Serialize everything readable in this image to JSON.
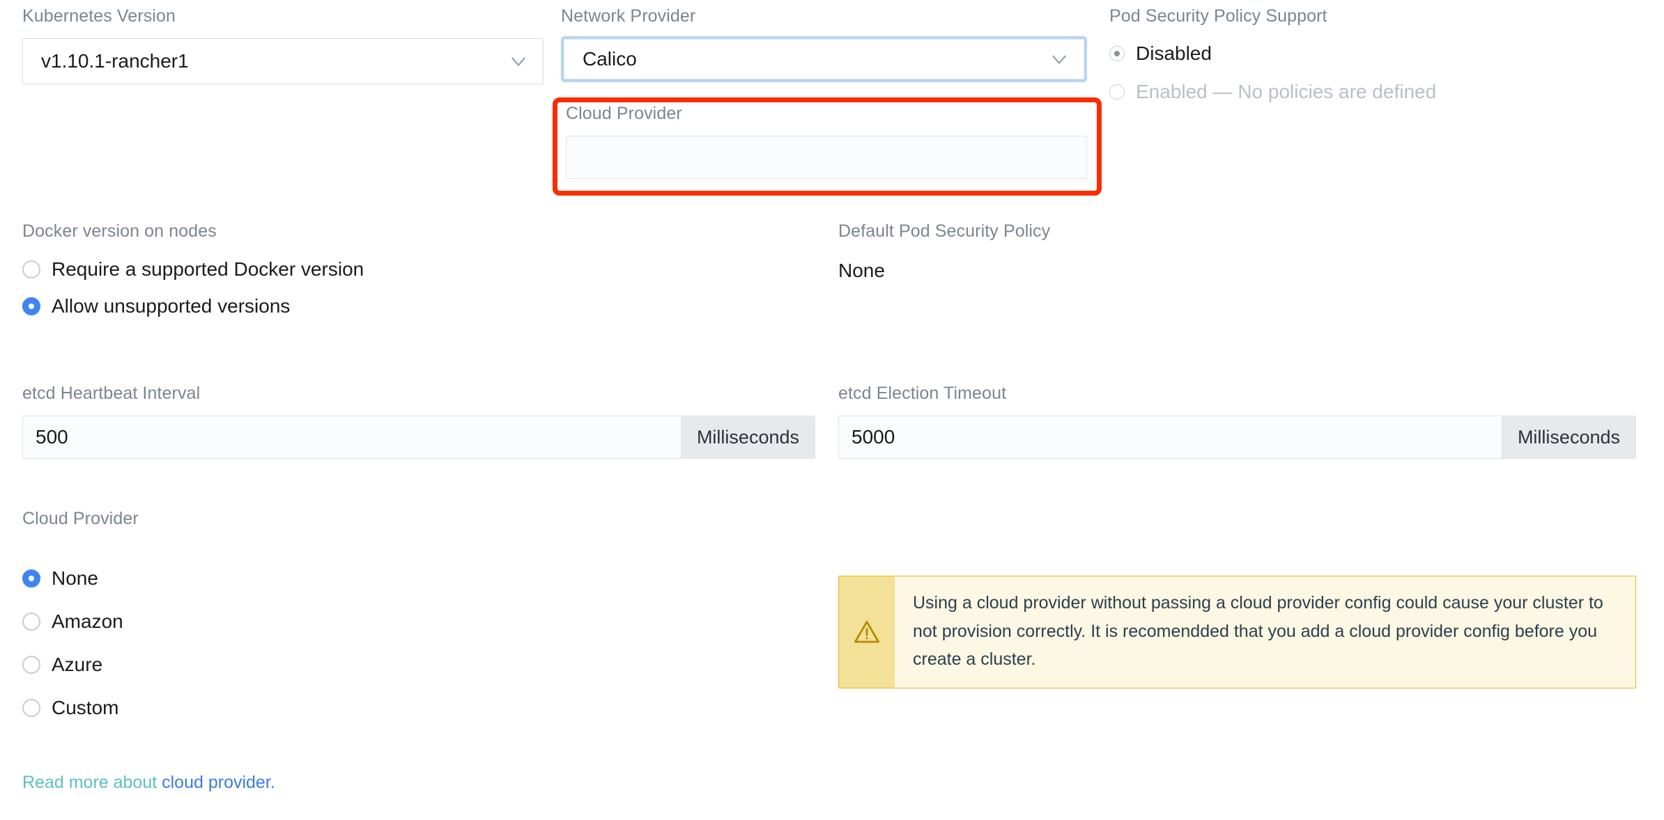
{
  "colors": {
    "accent_blue": "#3d86f2",
    "focus_ring": "#b8d4f5",
    "annotation_red": "#f92d00",
    "warning_border": "#e6b822",
    "warning_bg": "#fdf8e3",
    "warning_icon_bg": "#f2e196",
    "link_teal": "#5bc0bd",
    "link_blue": "#3a7ce0",
    "label_grey": "#7b8590"
  },
  "kubernetes_version": {
    "label": "Kubernetes Version",
    "value": "v1.10.1-rancher1",
    "chevron": "chevron-down-icon"
  },
  "network_provider": {
    "label": "Network Provider",
    "value": "Calico",
    "chevron": "chevron-down-icon",
    "focused": true
  },
  "cloud_provider_select": {
    "label": "Cloud Provider",
    "value": "",
    "highlighted": true
  },
  "pod_security_policy_support": {
    "label": "Pod Security Policy Support",
    "options": [
      {
        "label": "Disabled",
        "selected": true,
        "disabled": false
      },
      {
        "label": "Enabled — No policies are defined",
        "selected": false,
        "disabled": true
      }
    ]
  },
  "docker_version": {
    "label": "Docker version on nodes",
    "options": [
      {
        "label": "Require a supported Docker version",
        "selected": false
      },
      {
        "label": "Allow unsupported versions",
        "selected": true
      }
    ]
  },
  "default_pod_security_policy": {
    "label": "Default Pod Security Policy",
    "value": "None"
  },
  "etcd_heartbeat_interval": {
    "label": "etcd Heartbeat Interval",
    "value": "500",
    "unit": "Milliseconds"
  },
  "etcd_election_timeout": {
    "label": "etcd Election Timeout",
    "value": "5000",
    "unit": "Milliseconds"
  },
  "cloud_provider_radios": {
    "label": "Cloud Provider",
    "options": [
      {
        "label": "None",
        "selected": true
      },
      {
        "label": "Amazon",
        "selected": false
      },
      {
        "label": "Azure",
        "selected": false
      },
      {
        "label": "Custom",
        "selected": false
      }
    ]
  },
  "warning": {
    "icon": "warning-triangle-icon",
    "text": "Using a cloud provider without passing a cloud provider config could cause your cluster to not provision correctly. It is recomendded that you add a cloud provider config before you create a cluster."
  },
  "read_more": {
    "lead": "Read more about ",
    "link": "cloud provider."
  }
}
